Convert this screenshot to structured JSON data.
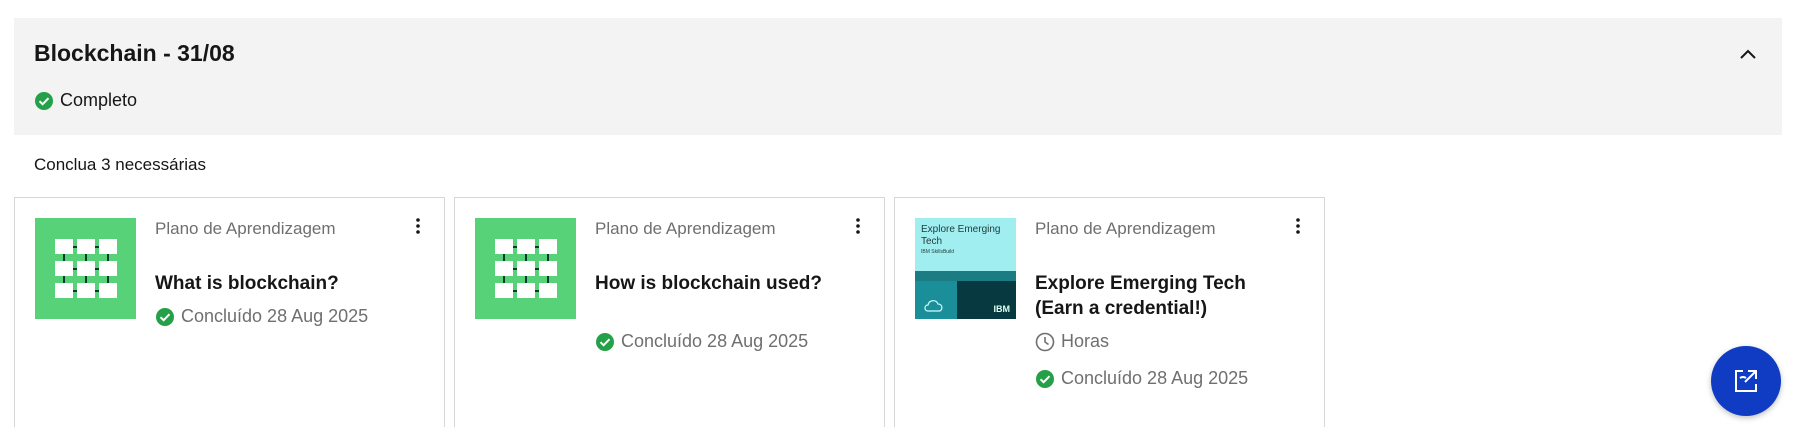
{
  "section": {
    "title": "Blockchain - 31/08",
    "status": "Completo",
    "status_color": "#24a148"
  },
  "required_note": "Conclua 3 necessárias",
  "cards": [
    {
      "type": "Plano de Aprendizagem",
      "title": "What is blockchain?",
      "completed": "Concluído 28 Aug 2025",
      "thumb_icon": "blockchain-grid-icon"
    },
    {
      "type": "Plano de Aprendizagem",
      "title": "How is blockchain used?",
      "completed": "Concluído 28 Aug 2025",
      "thumb_icon": "blockchain-grid-icon"
    },
    {
      "type": "Plano de Aprendizagem",
      "title": "Explore Emerging Tech (Earn a credential!)",
      "duration": "Horas",
      "completed": "Concluído 28 Aug 2025",
      "thumb": {
        "headline": "Explore Emerging Tech",
        "subtext": "IBM SkillsBuild",
        "brand": "IBM"
      }
    }
  ],
  "colors": {
    "thumb_green": "#57d279",
    "fab_blue": "#0f3cc2"
  }
}
